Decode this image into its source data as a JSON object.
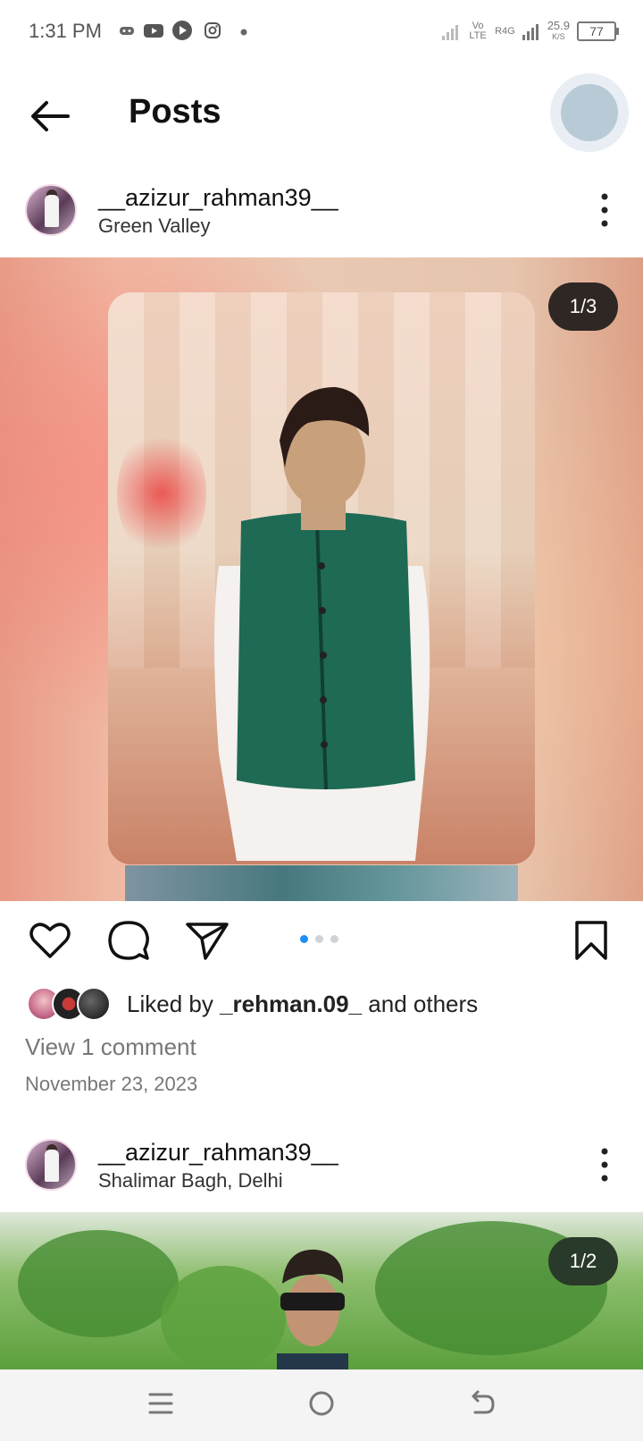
{
  "status_bar": {
    "time": "1:31 PM",
    "volte": "Vo LTE",
    "network": "R4G",
    "speed": "25.9",
    "speed_unit": "K/S",
    "battery": "77"
  },
  "header": {
    "title": "Posts"
  },
  "posts": [
    {
      "username": "__azizur_rahman39__",
      "location": "Green Valley",
      "counter": "1/3",
      "liked_prefix": "Liked by",
      "liked_user": "_rehman.09_",
      "liked_suffix": "and others",
      "view_comments": "View 1 comment",
      "date": "November 23, 2023"
    },
    {
      "username": "__azizur_rahman39__",
      "location": "Shalimar Bagh, Delhi",
      "counter": "1/2"
    }
  ],
  "colors": {
    "accent_dot": "#1d8ff0",
    "counter_bg": "#2f2723"
  },
  "icons": [
    "back-arrow-icon",
    "heart-icon",
    "comment-icon",
    "share-icon",
    "bookmark-icon",
    "more-icon",
    "menu-icon",
    "home-icon",
    "back-nav-icon"
  ]
}
